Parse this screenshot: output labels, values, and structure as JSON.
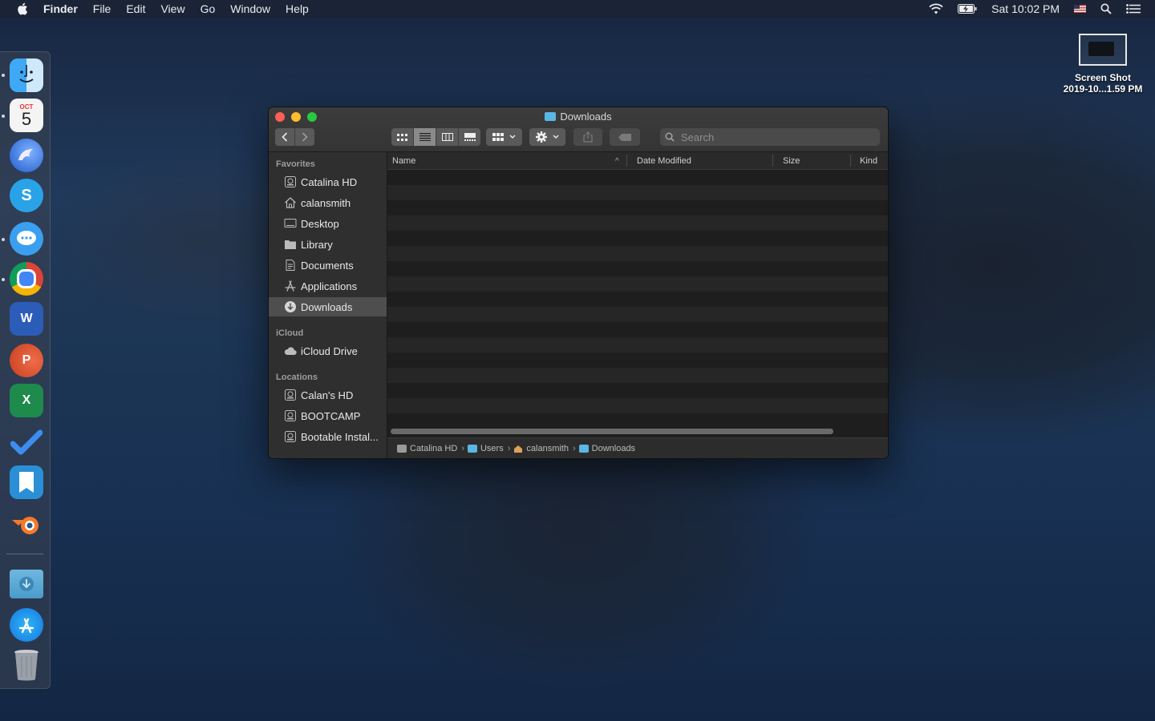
{
  "menubar": {
    "app": "Finder",
    "items": [
      "File",
      "Edit",
      "View",
      "Go",
      "Window",
      "Help"
    ],
    "clock": "Sat 10:02 PM",
    "status_icons": [
      "wifi-icon",
      "battery-icon",
      "flag-icon",
      "spotlight-icon",
      "notification-center-icon"
    ]
  },
  "desktop": {
    "file_name_line1": "Screen Shot",
    "file_name_line2": "2019-10...1.59 PM"
  },
  "dock": {
    "apps": [
      "finder",
      "calendar",
      "thunderbird",
      "skype",
      "messenger",
      "chrome",
      "word",
      "powerpoint",
      "excel",
      "todo",
      "kindle",
      "blender",
      "downloads-folder",
      "app-store",
      "trash"
    ],
    "calendar_month": "OCT",
    "calendar_day": "5",
    "word_letter": "W",
    "powerpoint_letter": "P",
    "excel_letter": "X",
    "skype_letter": "S"
  },
  "window": {
    "title": "Downloads",
    "search_placeholder": "Search",
    "sidebar": {
      "favorites_header": "Favorites",
      "favorites": [
        "Catalina HD",
        "calansmith",
        "Desktop",
        "Library",
        "Documents",
        "Applications",
        "Downloads"
      ],
      "icloud_header": "iCloud",
      "icloud": [
        "iCloud Drive"
      ],
      "locations_header": "Locations",
      "locations": [
        "Calan's HD",
        "BOOTCAMP",
        "Bootable Instal..."
      ]
    },
    "columns": {
      "name": "Name",
      "date_modified": "Date Modified",
      "size": "Size",
      "kind": "Kind",
      "sort_indicator": "^"
    },
    "path": [
      "Catalina HD",
      "Users",
      "calansmith",
      "Downloads"
    ],
    "path_separator": "›"
  }
}
